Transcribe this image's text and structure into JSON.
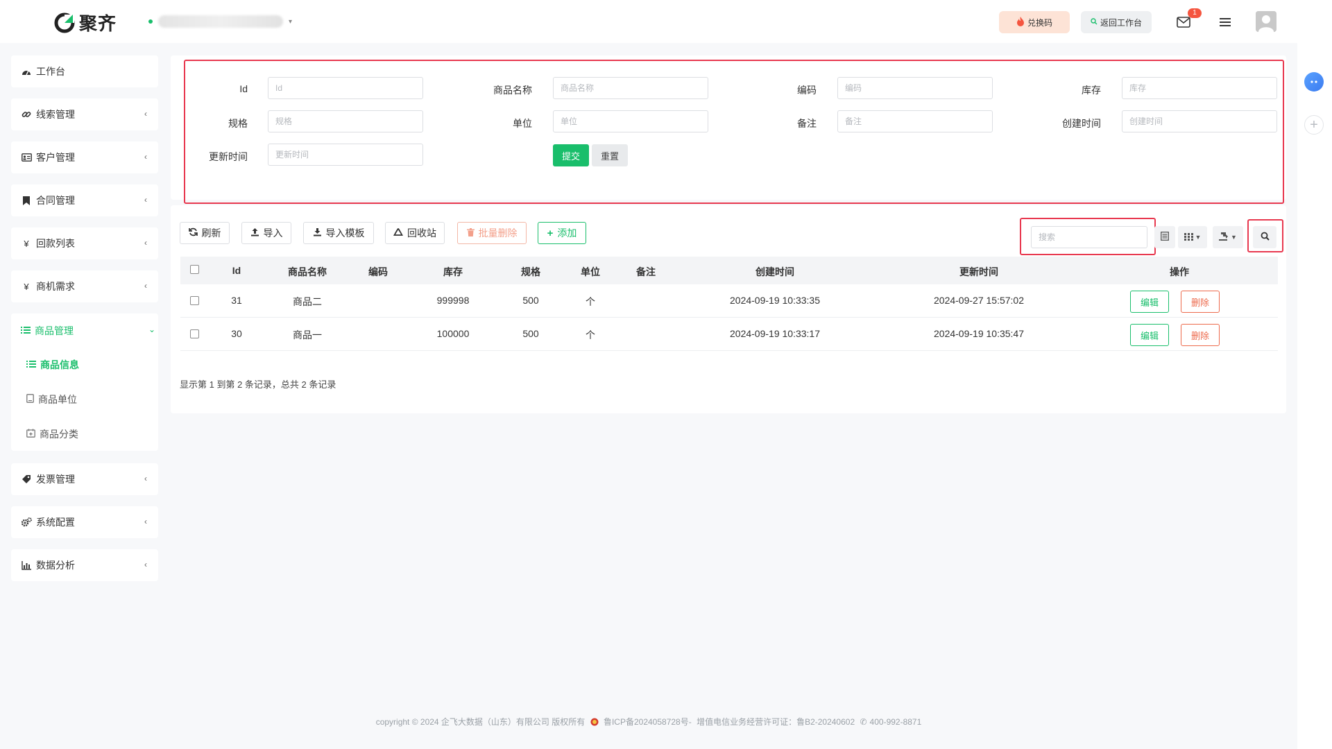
{
  "header": {
    "brand": "聚齐",
    "exchange_label": "兑换码",
    "back_label": "返回工作台",
    "mail_badge": "1"
  },
  "sidebar": {
    "items": [
      {
        "label": "工作台",
        "icon": "dashboard-icon"
      },
      {
        "label": "线索管理",
        "icon": "link-icon"
      },
      {
        "label": "客户管理",
        "icon": "id-card-icon"
      },
      {
        "label": "合同管理",
        "icon": "bookmark-icon"
      },
      {
        "label": "回款列表",
        "icon": "yen-icon"
      },
      {
        "label": "商机需求",
        "icon": "yen-icon"
      },
      {
        "label": "商品管理",
        "icon": "list-icon"
      },
      {
        "label": "发票管理",
        "icon": "tag-icon"
      },
      {
        "label": "系统配置",
        "icon": "gears-icon"
      },
      {
        "label": "数据分析",
        "icon": "bar-chart-icon"
      }
    ],
    "sub_items": [
      {
        "label": "商品信息",
        "icon": "list-icon"
      },
      {
        "label": "商品单位",
        "icon": "file-icon"
      },
      {
        "label": "商品分类",
        "icon": "calendar-icon"
      }
    ]
  },
  "filters": {
    "id": {
      "label": "Id",
      "placeholder": "Id"
    },
    "name": {
      "label": "商品名称",
      "placeholder": "商品名称"
    },
    "code": {
      "label": "编码",
      "placeholder": "编码"
    },
    "stock": {
      "label": "库存",
      "placeholder": "库存"
    },
    "spec": {
      "label": "规格",
      "placeholder": "规格"
    },
    "unit": {
      "label": "单位",
      "placeholder": "单位"
    },
    "remark": {
      "label": "备注",
      "placeholder": "备注"
    },
    "created": {
      "label": "创建时间",
      "placeholder": "创建时间"
    },
    "updated": {
      "label": "更新时间",
      "placeholder": "更新时间"
    },
    "submit_label": "提交",
    "reset_label": "重置"
  },
  "toolbar": {
    "refresh": "刷新",
    "import": "导入",
    "import_template": "导入模板",
    "recycle": "回收站",
    "batch_delete": "批量删除",
    "add": "添加",
    "search_placeholder": "搜索"
  },
  "table": {
    "columns": [
      "Id",
      "商品名称",
      "编码",
      "库存",
      "规格",
      "单位",
      "备注",
      "创建时间",
      "更新时间",
      "操作"
    ],
    "rows": [
      {
        "id": "31",
        "name": "商品二",
        "code": "",
        "stock": "999998",
        "spec": "500",
        "unit": "个",
        "remark": "",
        "created": "2024-09-19 10:33:35",
        "updated": "2024-09-27 15:57:02"
      },
      {
        "id": "30",
        "name": "商品一",
        "code": "",
        "stock": "100000",
        "spec": "500",
        "unit": "个",
        "remark": "",
        "created": "2024-09-19 10:33:17",
        "updated": "2024-09-19 10:35:47"
      }
    ],
    "edit_label": "编辑",
    "delete_label": "删除",
    "pager_info": "显示第 1 到第 2 条记录，总共 2 条记录"
  },
  "footer": {
    "copyright": "copyright © 2024 企飞大数据（山东）有限公司 版权所有",
    "icp": "鲁ICP备2024058728号-",
    "license": "增值电信业务经营许可证：鲁B2-20240602",
    "phone": "400-992-8871"
  },
  "colors": {
    "accent": "#19be6b",
    "danger": "#ed6a4c",
    "highlight_box": "#e8384f",
    "badge": "#f5553f"
  }
}
